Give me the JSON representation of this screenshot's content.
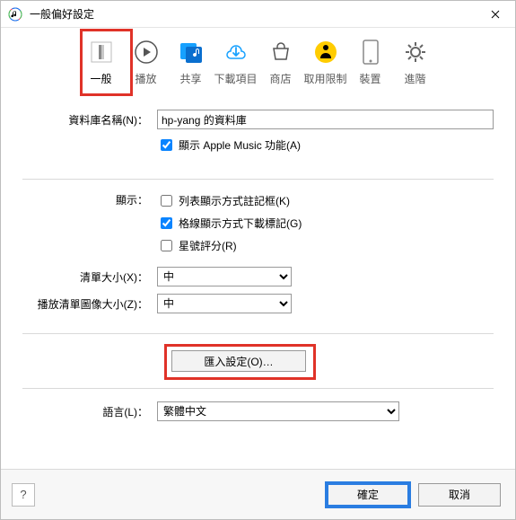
{
  "window": {
    "title": "一般偏好設定"
  },
  "tabs": {
    "general": {
      "label": "一般"
    },
    "playback": {
      "label": "播放"
    },
    "sharing": {
      "label": "共享"
    },
    "downloads": {
      "label": "下載項目"
    },
    "store": {
      "label": "商店"
    },
    "restrict": {
      "label": "取用限制"
    },
    "devices": {
      "label": "裝置"
    },
    "advanced": {
      "label": "進階"
    }
  },
  "library": {
    "name_label": "資料庫名稱(N)：",
    "name_value": "hp-yang 的資料庫",
    "show_apple_music_label": "顯示 Apple Music 功能(A)",
    "show_apple_music_checked": true
  },
  "display": {
    "label": "顯示：",
    "list_notes_label": "列表顯示方式註記框(K)",
    "list_notes_checked": false,
    "grid_dl_label": "格線顯示方式下載標記(G)",
    "grid_dl_checked": true,
    "star_label": "星號評分(R)",
    "star_checked": false
  },
  "sizes": {
    "list_label": "清單大小(X)：",
    "list_value": "中",
    "art_label": "播放清單圖像大小(Z)：",
    "art_value": "中"
  },
  "import": {
    "button": "匯入設定(O)…"
  },
  "language": {
    "label": "語言(L)：",
    "value": "繁體中文"
  },
  "footer": {
    "help": "?",
    "ok": "確定",
    "cancel": "取消"
  }
}
